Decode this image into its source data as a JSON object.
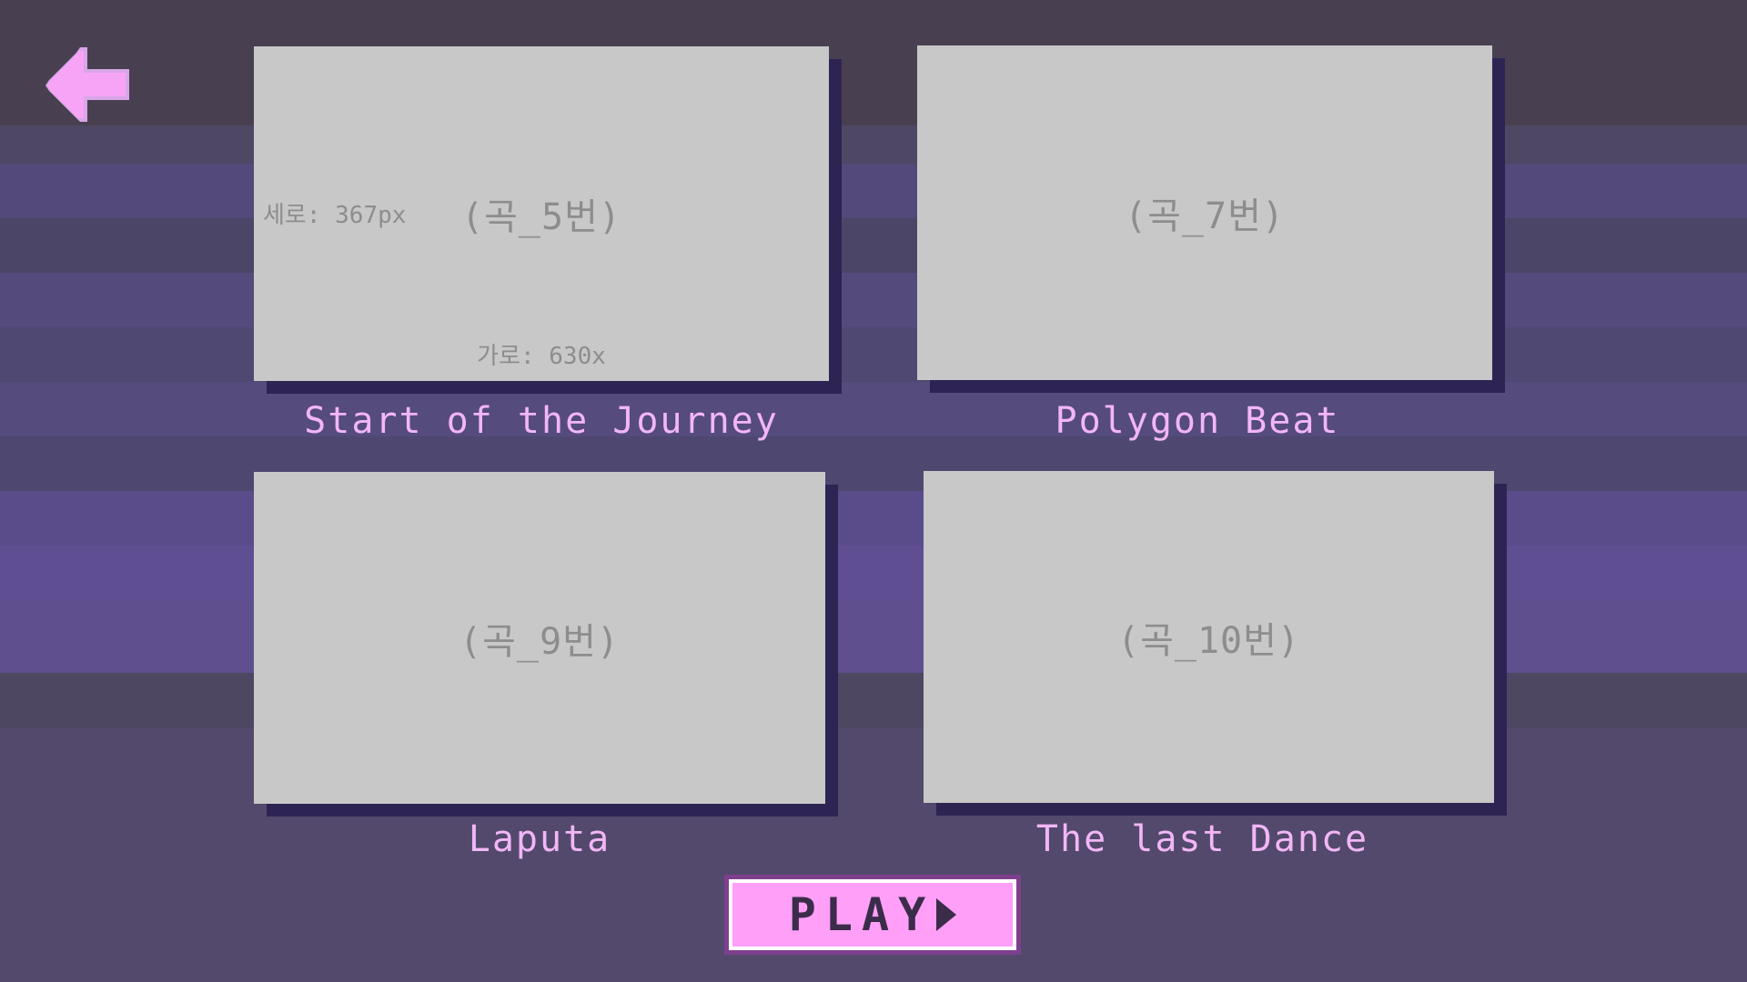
{
  "songs": [
    {
      "placeholder": "(곡_5번)",
      "title": "Start of the Journey",
      "height_note": "세로: 367px",
      "width_note": "가로: 630x"
    },
    {
      "placeholder": "(곡_7번)",
      "title": "Polygon Beat"
    },
    {
      "placeholder": "(곡_9번)",
      "title": "Laputa"
    },
    {
      "placeholder": "(곡_10번)",
      "title": "The last Dance"
    }
  ],
  "play_button": {
    "label": "PLAY"
  },
  "icons": {
    "back": "arrow-left-icon",
    "play": "play-triangle-icon"
  },
  "colors": {
    "accent": "#ff9ff8",
    "title_text": "#f2b6f6",
    "card_face": "#c8c8c8",
    "card_shadow": "#2e2454"
  }
}
